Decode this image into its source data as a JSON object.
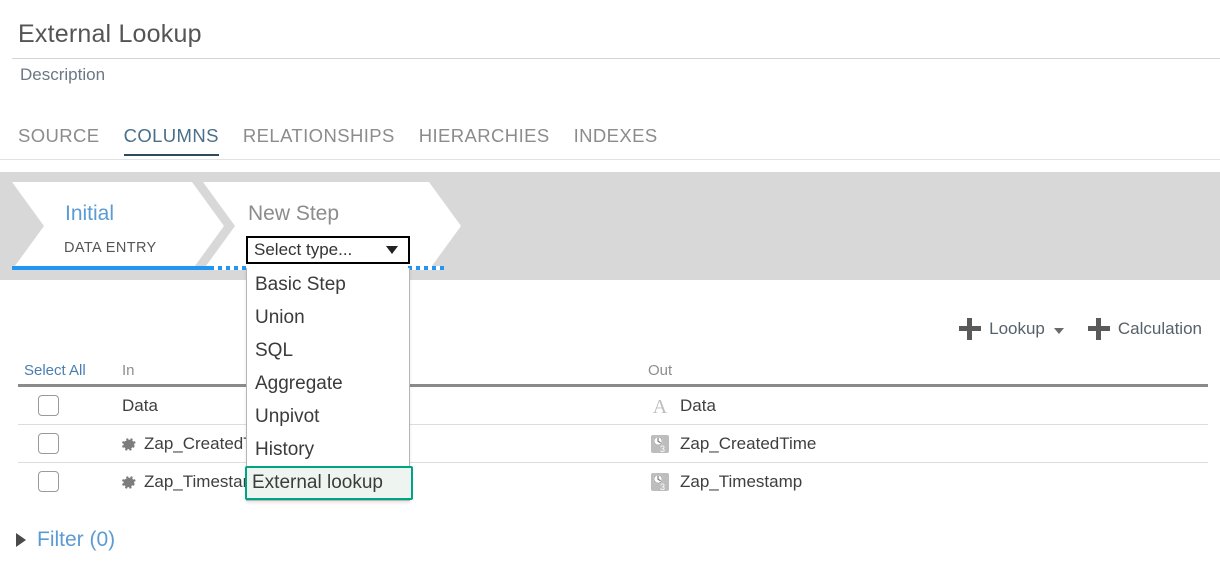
{
  "header": {
    "title": "External Lookup",
    "description": "Description"
  },
  "tabs": [
    {
      "label": "SOURCE",
      "active": false
    },
    {
      "label": "COLUMNS",
      "active": true
    },
    {
      "label": "RELATIONSHIPS",
      "active": false
    },
    {
      "label": "HIERARCHIES",
      "active": false
    },
    {
      "label": "INDEXES",
      "active": false
    }
  ],
  "pipeline": {
    "steps": [
      {
        "title": "Initial",
        "subtitle": "DATA ENTRY"
      },
      {
        "title": "New Step",
        "subtitle": ""
      }
    ],
    "select": {
      "value": "Select type...",
      "caret_icon": "caret-down-icon",
      "options": [
        "Basic Step",
        "Union",
        "SQL",
        "Aggregate",
        "Unpivot",
        "History",
        "External lookup"
      ],
      "highlighted_option": "External lookup"
    },
    "accent_color": "#2196f3",
    "band_color": "#d8d8d8",
    "highlight_color": "#00a383"
  },
  "actions": [
    {
      "label": "Lookup",
      "icon": "plus-icon",
      "has_chevron": true
    },
    {
      "label": "Calculation",
      "icon": "plus-icon",
      "has_chevron": false
    }
  ],
  "table": {
    "select_all_label": "Select All",
    "columns": [
      "In",
      "Out"
    ],
    "rows": [
      {
        "checked": false,
        "in_icon": "",
        "in": "Data",
        "out_icon": "text-type-icon",
        "out": "Data"
      },
      {
        "checked": false,
        "in_icon": "gear-icon",
        "in": "Zap_CreatedTime",
        "out_icon": "datetime-type-icon",
        "out": "Zap_CreatedTime"
      },
      {
        "checked": false,
        "in_icon": "gear-icon",
        "in": "Zap_Timestamp",
        "out_icon": "datetime-type-icon",
        "out": "Zap_Timestamp"
      }
    ]
  },
  "filter": {
    "label": "Filter (0)",
    "icon": "triangle-right-icon"
  }
}
